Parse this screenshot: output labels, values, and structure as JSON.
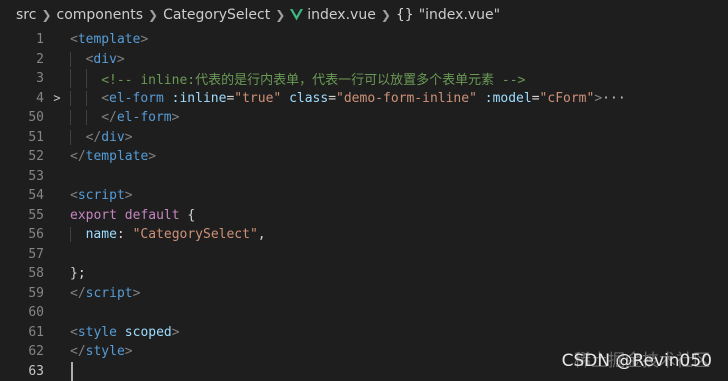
{
  "breadcrumb": {
    "items": [
      "src",
      "components",
      "CategorySelect",
      "index.vue",
      "\"index.vue\""
    ],
    "braces": "{}"
  },
  "editor": {
    "lines": [
      {
        "number": "1",
        "fold": "",
        "indent": 0,
        "tokens": [
          [
            "punct",
            "<"
          ],
          [
            "tag",
            "template"
          ],
          [
            "punct",
            ">"
          ]
        ]
      },
      {
        "number": "2",
        "fold": "",
        "indent": 1,
        "tokens": [
          [
            "punct",
            "<"
          ],
          [
            "tag",
            "div"
          ],
          [
            "punct",
            ">"
          ]
        ]
      },
      {
        "number": "3",
        "fold": "",
        "indent": 2,
        "tokens": [
          [
            "cmt",
            "<!-- inline:代表的是行内表单，代表一行可以放置多个表单元素 -->"
          ]
        ]
      },
      {
        "number": "4",
        "fold": ">",
        "indent": 2,
        "tokens": [
          [
            "punct",
            "<"
          ],
          [
            "tag",
            "el-form"
          ],
          [
            "plain",
            " "
          ],
          [
            "attr",
            ":inline"
          ],
          [
            "plain",
            "="
          ],
          [
            "str",
            "\"true\""
          ],
          [
            "plain",
            " "
          ],
          [
            "attr",
            "class"
          ],
          [
            "plain",
            "="
          ],
          [
            "str",
            "\"demo-form-inline\""
          ],
          [
            "plain",
            " "
          ],
          [
            "attr",
            ":model"
          ],
          [
            "plain",
            "="
          ],
          [
            "str",
            "\"cForm\""
          ],
          [
            "punct",
            ">"
          ],
          [
            "ellipsis",
            "···"
          ]
        ]
      },
      {
        "number": "50",
        "fold": "",
        "indent": 2,
        "tokens": [
          [
            "punct",
            "</"
          ],
          [
            "tag",
            "el-form"
          ],
          [
            "punct",
            ">"
          ]
        ]
      },
      {
        "number": "51",
        "fold": "",
        "indent": 1,
        "tokens": [
          [
            "punct",
            "</"
          ],
          [
            "tag",
            "div"
          ],
          [
            "punct",
            ">"
          ]
        ]
      },
      {
        "number": "52",
        "fold": "",
        "indent": 0,
        "tokens": [
          [
            "punct",
            "</"
          ],
          [
            "tag",
            "template"
          ],
          [
            "punct",
            ">"
          ]
        ]
      },
      {
        "number": "53",
        "fold": "",
        "indent": 0,
        "tokens": []
      },
      {
        "number": "54",
        "fold": "",
        "indent": 0,
        "tokens": [
          [
            "punct",
            "<"
          ],
          [
            "tag",
            "script"
          ],
          [
            "punct",
            ">"
          ]
        ]
      },
      {
        "number": "55",
        "fold": "",
        "indent": 0,
        "tokens": [
          [
            "kw",
            "export"
          ],
          [
            "plain",
            " "
          ],
          [
            "kw",
            "default"
          ],
          [
            "plain",
            " {"
          ]
        ]
      },
      {
        "number": "56",
        "fold": "",
        "indent": 1,
        "tokens": [
          [
            "attr",
            "name"
          ],
          [
            "plain",
            ": "
          ],
          [
            "str",
            "\"CategorySelect\""
          ],
          [
            "plain",
            ","
          ]
        ]
      },
      {
        "number": "57",
        "fold": "",
        "indent": 0,
        "tokens": []
      },
      {
        "number": "58",
        "fold": "",
        "indent": 0,
        "tokens": [
          [
            "plain",
            "};"
          ]
        ]
      },
      {
        "number": "59",
        "fold": "",
        "indent": 0,
        "tokens": [
          [
            "punct",
            "</"
          ],
          [
            "tag",
            "script"
          ],
          [
            "punct",
            ">"
          ]
        ]
      },
      {
        "number": "60",
        "fold": "",
        "indent": 0,
        "tokens": []
      },
      {
        "number": "61",
        "fold": "",
        "indent": 0,
        "tokens": [
          [
            "punct",
            "<"
          ],
          [
            "tag",
            "style"
          ],
          [
            "plain",
            " "
          ],
          [
            "attr",
            "scoped"
          ],
          [
            "punct",
            ">"
          ]
        ]
      },
      {
        "number": "62",
        "fold": "",
        "indent": 0,
        "tokens": [
          [
            "punct",
            "</"
          ],
          [
            "tag",
            "style"
          ],
          [
            "punct",
            ">"
          ]
        ]
      },
      {
        "number": "63",
        "fold": "",
        "indent": 0,
        "tokens": [],
        "active": true
      }
    ]
  },
  "watermark": {
    "prefix": "稀土掘金技术社区",
    "text": "CSDN @Revin050"
  }
}
